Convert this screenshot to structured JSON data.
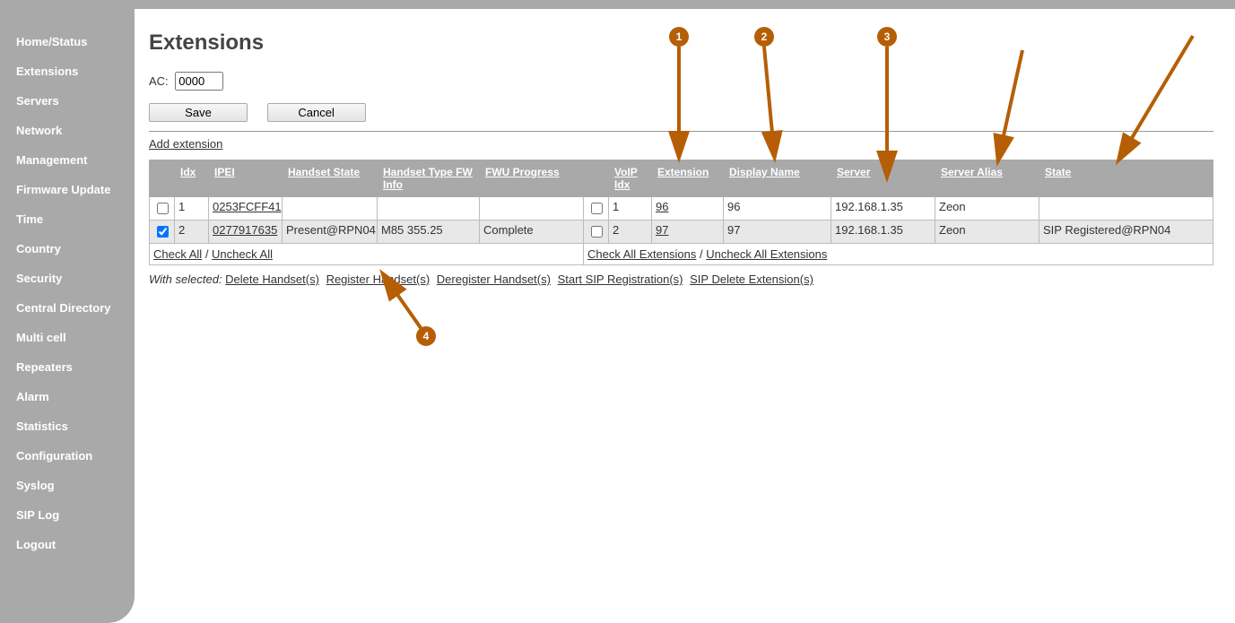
{
  "sidebar": {
    "items": [
      {
        "label": "Home/Status"
      },
      {
        "label": "Extensions"
      },
      {
        "label": "Servers"
      },
      {
        "label": "Network"
      },
      {
        "label": "Management"
      },
      {
        "label": "Firmware Update"
      },
      {
        "label": "Time"
      },
      {
        "label": "Country"
      },
      {
        "label": "Security"
      },
      {
        "label": "Central Directory"
      },
      {
        "label": "Multi cell"
      },
      {
        "label": "Repeaters"
      },
      {
        "label": "Alarm"
      },
      {
        "label": "Statistics"
      },
      {
        "label": "Configuration"
      },
      {
        "label": "Syslog"
      },
      {
        "label": "SIP Log"
      },
      {
        "label": "Logout"
      }
    ]
  },
  "page": {
    "title": "Extensions",
    "ac_label": "AC:",
    "ac_value": "0000",
    "save_label": "Save",
    "cancel_label": "Cancel",
    "add_extension_label": "Add extension"
  },
  "table": {
    "headers": {
      "idx": "Idx",
      "ipei": "IPEI",
      "handset_state": "Handset State",
      "handset_type": "Handset Type FW Info",
      "fwu_progress": "FWU Progress",
      "voip_idx": "VoIP Idx",
      "extension": "Extension",
      "display_name": "Display Name",
      "server": "Server",
      "server_alias": "Server Alias",
      "state": "State"
    },
    "rows": [
      {
        "checked": false,
        "idx": "1",
        "ipei": "0253FCFF41",
        "handset_state": "",
        "handset_type": "",
        "fwu_progress": "",
        "voip_checked": false,
        "voip_idx": "1",
        "extension": "96",
        "display_name": "96",
        "server": "192.168.1.35",
        "server_alias": "Zeon",
        "state": ""
      },
      {
        "checked": true,
        "idx": "2",
        "ipei": "0277917635",
        "handset_state": "Present@RPN04",
        "handset_type": "M85 355.25",
        "fwu_progress": "Complete",
        "voip_checked": false,
        "voip_idx": "2",
        "extension": "97",
        "display_name": "97",
        "server": "192.168.1.35",
        "server_alias": "Zeon",
        "state": "SIP Registered@RPN04"
      }
    ],
    "footer": {
      "check_all": "Check All",
      "uncheck_all": "Uncheck All",
      "check_all_ext": "Check All Extensions",
      "uncheck_all_ext": "Uncheck All Extensions"
    }
  },
  "actions": {
    "prefix": "With selected:",
    "delete_handsets": "Delete Handset(s)",
    "register_handsets": "Register Handset(s)",
    "deregister_handsets": "Deregister Handset(s)",
    "start_sip": "Start SIP Registration(s)",
    "sip_delete": "SIP Delete Extension(s)"
  },
  "annotations": {
    "n1": "1",
    "n2": "2",
    "n3": "3",
    "n4": "4"
  }
}
